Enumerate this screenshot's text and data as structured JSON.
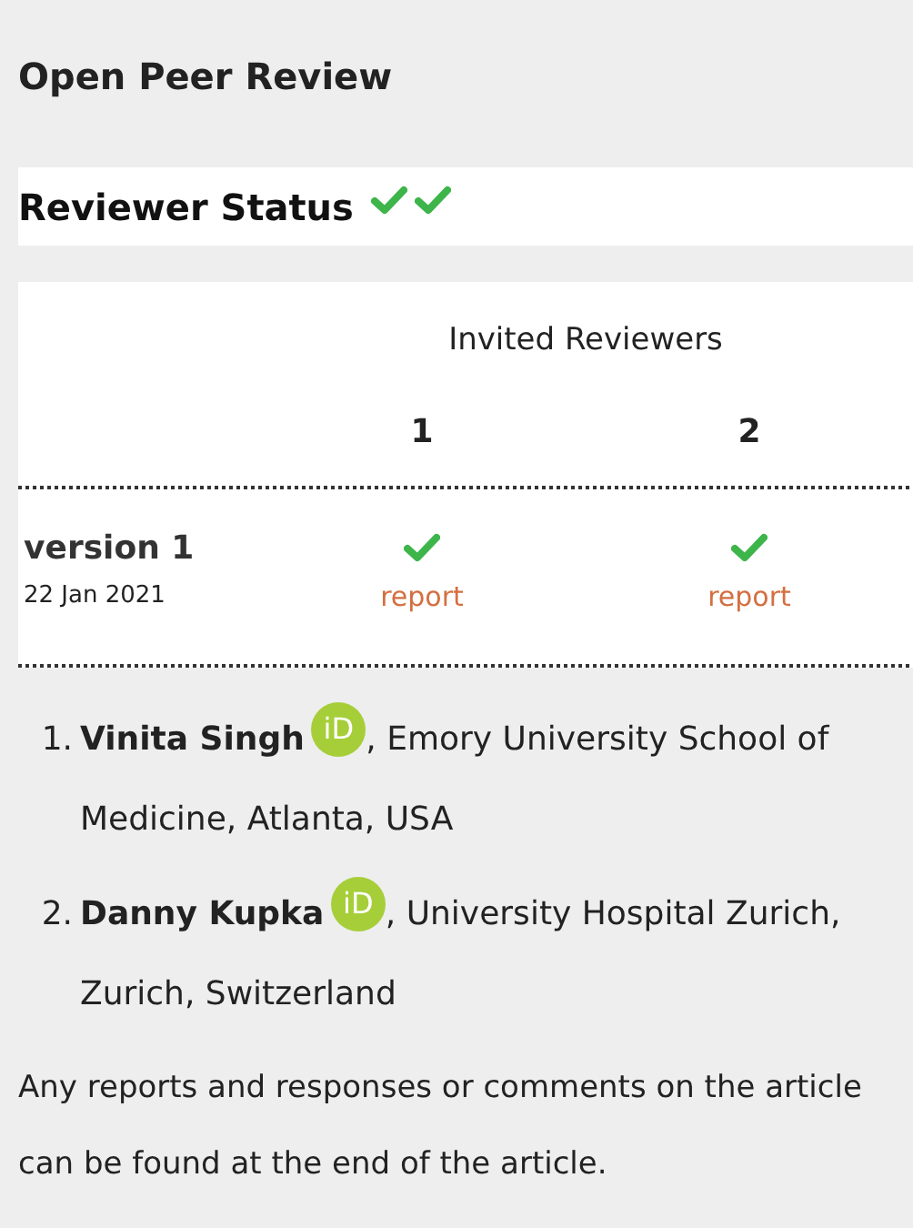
{
  "title": "Open Peer Review",
  "reviewer_status": {
    "label": "Reviewer Status",
    "checks": [
      {
        "approved": true
      },
      {
        "approved": true
      }
    ]
  },
  "table": {
    "header": "Invited Reviewers",
    "columns": [
      "1",
      "2"
    ],
    "rows": [
      {
        "version": "version 1",
        "date": "22 Jan 2021",
        "reviews": [
          {
            "approved": true,
            "link": "report"
          },
          {
            "approved": true,
            "link": "report"
          }
        ]
      }
    ]
  },
  "reviewers": [
    {
      "number": "1.",
      "name": "Vinita Singh",
      "orcid": "iD",
      "affiliation": ", Emory University School of Medicine, Atlanta, USA"
    },
    {
      "number": "2.",
      "name": "Danny Kupka",
      "orcid": "iD",
      "affiliation": ", University Hospital Zurich, Zurich, Switzerland"
    }
  ],
  "footer": "Any reports and responses or comments on the article can be found at the end of the article."
}
